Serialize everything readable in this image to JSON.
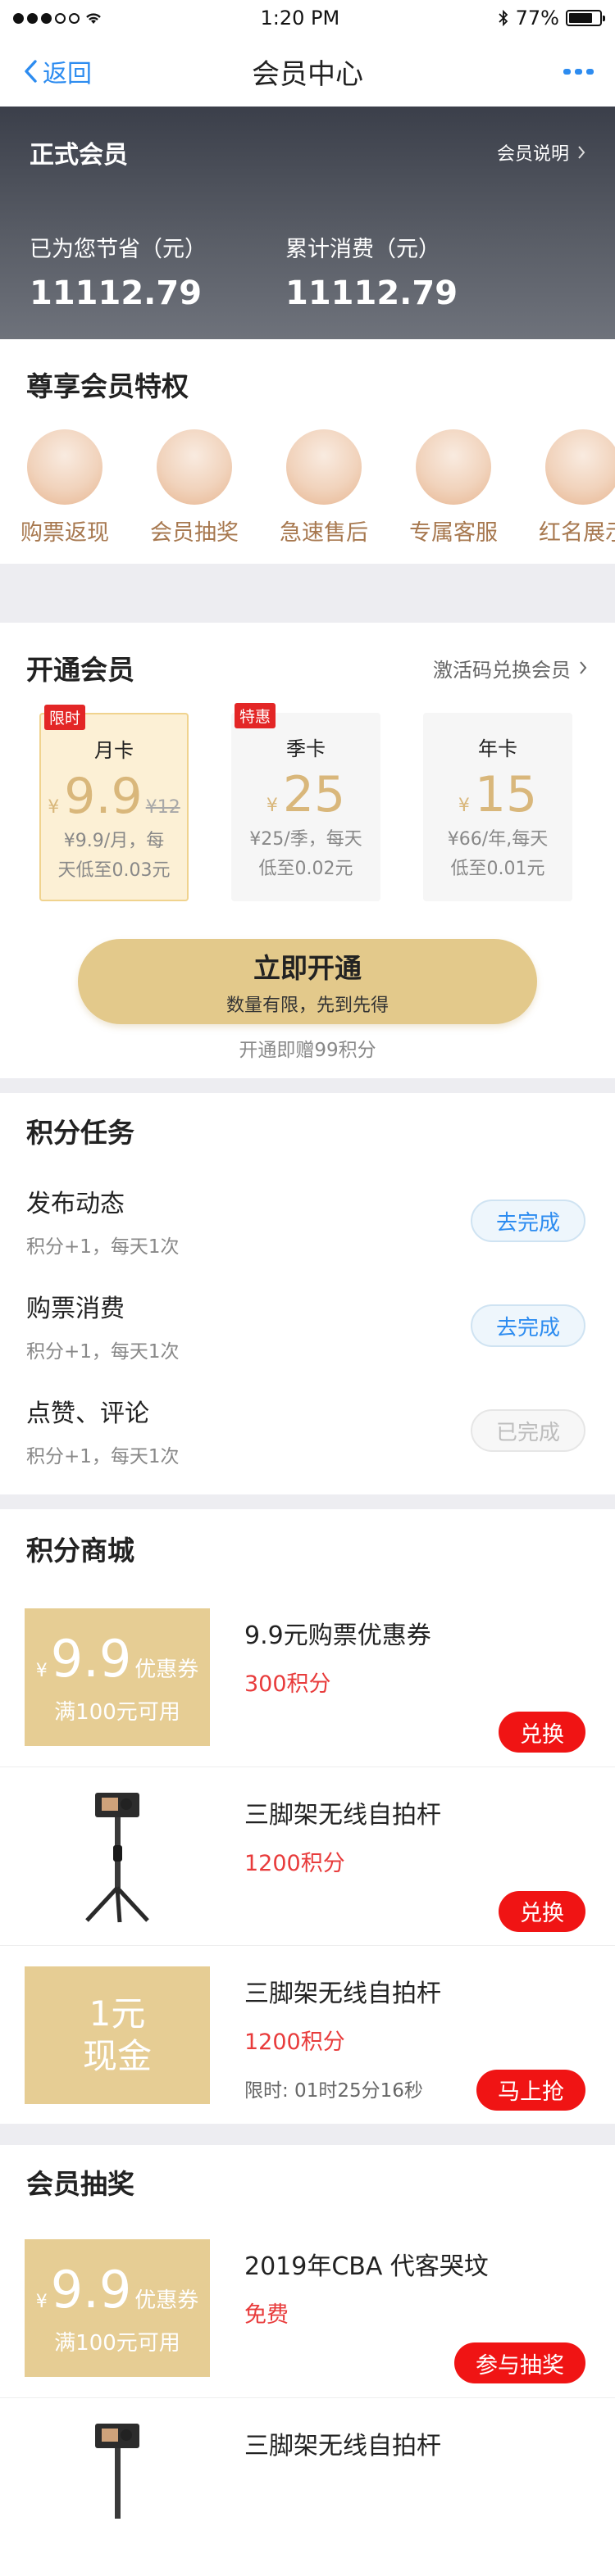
{
  "status_bar": {
    "time": "1:20 PM",
    "battery": "77%",
    "battery_level": 0.77
  },
  "nav": {
    "back_label": "返回",
    "title": "会员中心"
  },
  "membership": {
    "title": "正式会员",
    "info_link": "会员说明",
    "saved_label": "已为您节省（元）",
    "saved_value": "11112.79",
    "spent_label": "累计消费（元）",
    "spent_value": "11112.79"
  },
  "perks": {
    "title": "尊享会员特权",
    "items": [
      "购票返现",
      "会员抽奖",
      "急速售后",
      "专属客服",
      "红名展示"
    ]
  },
  "open_membership": {
    "title": "开通会员",
    "code_link": "激活码兑换会员",
    "cards": [
      {
        "badge": "限时",
        "name": "月卡",
        "currency": "¥",
        "price": "9.9",
        "old_price": "¥12",
        "desc_line1": "¥9.9/月，每",
        "desc_line2": "天低至0.03元"
      },
      {
        "badge": "特惠",
        "name": "季卡",
        "currency": "¥",
        "price": "25",
        "old_price": "",
        "desc_line1": "¥25/季，每天",
        "desc_line2": "低至0.02元"
      },
      {
        "badge": "",
        "name": "年卡",
        "currency": "¥",
        "price": "15",
        "old_price": "",
        "desc_line1": "¥66/年,每天",
        "desc_line2": "低至0.01元"
      }
    ],
    "button_main": "立即开通",
    "button_sub": "数量有限，先到先得",
    "bonus_note": "开通即赠99积分"
  },
  "points_tasks": {
    "title": "积分任务",
    "tasks": [
      {
        "name": "发布动态",
        "rule": "积分+1，每天1次",
        "action": "去完成"
      },
      {
        "name": "购票消费",
        "rule": "积分+1，每天1次",
        "action": "去完成"
      },
      {
        "name": "点赞、评论",
        "rule": "积分+1，每天1次",
        "action": "已完成"
      }
    ]
  },
  "points_mall": {
    "title": "积分商城",
    "items": [
      {
        "coupon_currency": "¥",
        "coupon_value": "9.9",
        "coupon_unit": "优惠券",
        "coupon_condition": "满100元可用",
        "name": "9.9元购票优惠券",
        "points": "300积分",
        "action": "兑换"
      },
      {
        "name": "三脚架无线自拍杆",
        "points": "1200积分",
        "action": "兑换"
      },
      {
        "cash_line1": "1元",
        "cash_line2": "现金",
        "name": "三脚架无线自拍杆",
        "points": "1200积分",
        "time_left": "限时: 01时25分16秒",
        "action": "马上抢"
      }
    ]
  },
  "lottery": {
    "title": "会员抽奖",
    "items": [
      {
        "coupon_currency": "¥",
        "coupon_value": "9.9",
        "coupon_unit": "优惠券",
        "coupon_condition": "满100元可用",
        "name": "2019年CBA 代客哭坟",
        "price": "免费",
        "action": "参与抽奖"
      },
      {
        "name": "三脚架无线自拍杆"
      }
    ]
  },
  "colors": {
    "accent": "#2d8cf0",
    "gold": "#e3c98b",
    "red": "#f01414"
  }
}
